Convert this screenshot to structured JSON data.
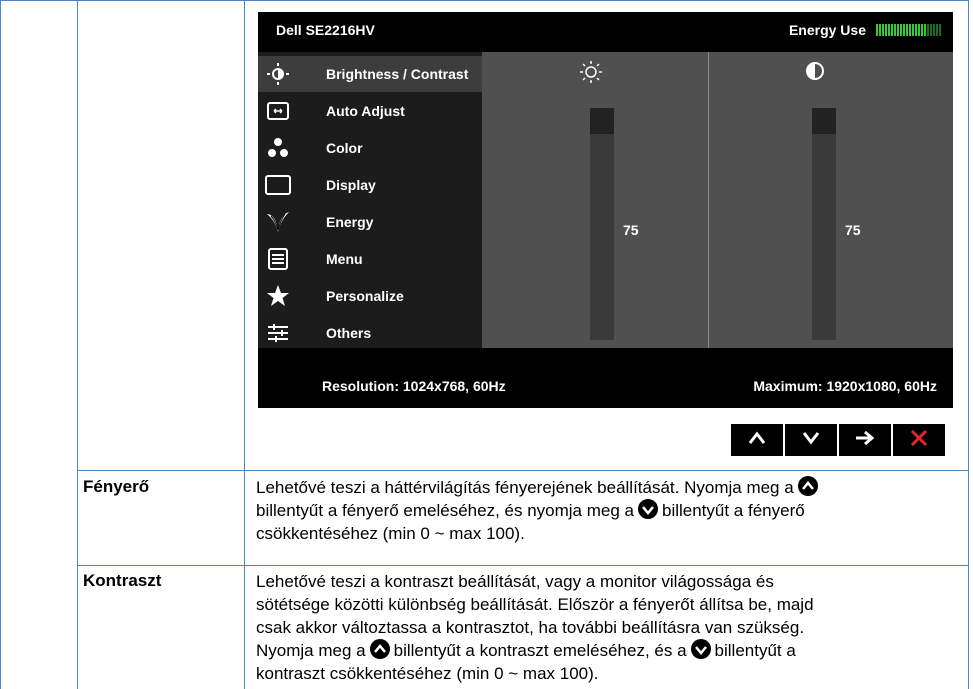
{
  "osd": {
    "title": "Dell SE2216HV",
    "energy_label": "Energy Use",
    "energy_level": 0.75,
    "menu": [
      {
        "label": "Brightness / Contrast",
        "icon": "brightness-icon",
        "active": true
      },
      {
        "label": "Auto Adjust",
        "icon": "auto-adjust-icon"
      },
      {
        "label": "Color",
        "icon": "color-icon"
      },
      {
        "label": "Display",
        "icon": "display-icon"
      },
      {
        "label": "Energy",
        "icon": "energy-icon"
      },
      {
        "label": "Menu",
        "icon": "menu-icon"
      },
      {
        "label": "Personalize",
        "icon": "star-icon"
      },
      {
        "label": "Others",
        "icon": "others-icon"
      }
    ],
    "brightness": {
      "value": "75",
      "icon": "sun-icon"
    },
    "contrast": {
      "value": "75",
      "icon": "contrast-icon"
    },
    "resolution": "Resolution: 1024x768, 60Hz",
    "maximum": "Maximum: 1920x1080, 60Hz",
    "nav_buttons": [
      "up-arrow-icon",
      "down-arrow-icon",
      "right-arrow-icon",
      "close-icon"
    ],
    "colors": {
      "accent_close": "#e3262b",
      "panel": "#505050",
      "menu": "#1c1c1c",
      "energy_on": "#33cc33",
      "energy_off": "#1f6b1f"
    }
  },
  "rows": [
    {
      "label": "Fényerő",
      "lines": [
        [
          "Lehetővé teszi a háttérvilágítás fényerejének beállítását. Nyomja meg a",
          "up"
        ],
        [
          "billentyűt a fényerő emeléséhez, és nyomja meg a",
          "down",
          "billentyűt a fényerő"
        ],
        [
          "csökkentéséhez (min 0 ~ max 100)."
        ]
      ]
    },
    {
      "label": "Kontraszt",
      "lines": [
        [
          "Lehetővé teszi a kontraszt beállítását, vagy a monitor világossága és"
        ],
        [
          "sötétsége közötti különbség beállítását. Először a fényerőt állítsa be, majd"
        ],
        [
          "csak akkor változtassa a kontrasztot, ha további beállításra van szükség."
        ],
        [
          "Nyomja meg a",
          "up",
          "billentyűt a kontraszt emeléséhez, és a",
          "down",
          "billentyűt a"
        ],
        [
          "kontraszt csökkentéséhez (min 0 ~ max 100)."
        ]
      ]
    }
  ]
}
